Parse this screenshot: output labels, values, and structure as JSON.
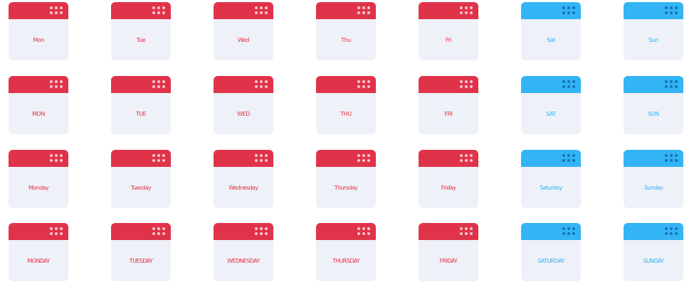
{
  "colors": {
    "weekday_accent": "#e0334a",
    "weekend_accent": "#33b4f5",
    "body": "#eef1f7"
  },
  "icon": "calendar-icon",
  "rows": [
    {
      "style": "short-capitalized",
      "labels": [
        "Mon",
        "Tue",
        "Wed",
        "Thu",
        "Fri",
        "Sat",
        "Sun"
      ]
    },
    {
      "style": "short-uppercase",
      "labels": [
        "MON",
        "TUE",
        "WED",
        "THU",
        "FRI",
        "SAT",
        "SUN"
      ]
    },
    {
      "style": "full-capitalized",
      "labels": [
        "Monday",
        "Tuesday",
        "Wednesday",
        "Thursday",
        "Friday",
        "Saturday",
        "Sunday"
      ]
    },
    {
      "style": "full-uppercase",
      "labels": [
        "MONDAY",
        "TUESDAY",
        "WEDNESDAY",
        "THURSDAY",
        "FRIDAY",
        "SATURDAY",
        "SUNDAY"
      ]
    }
  ]
}
